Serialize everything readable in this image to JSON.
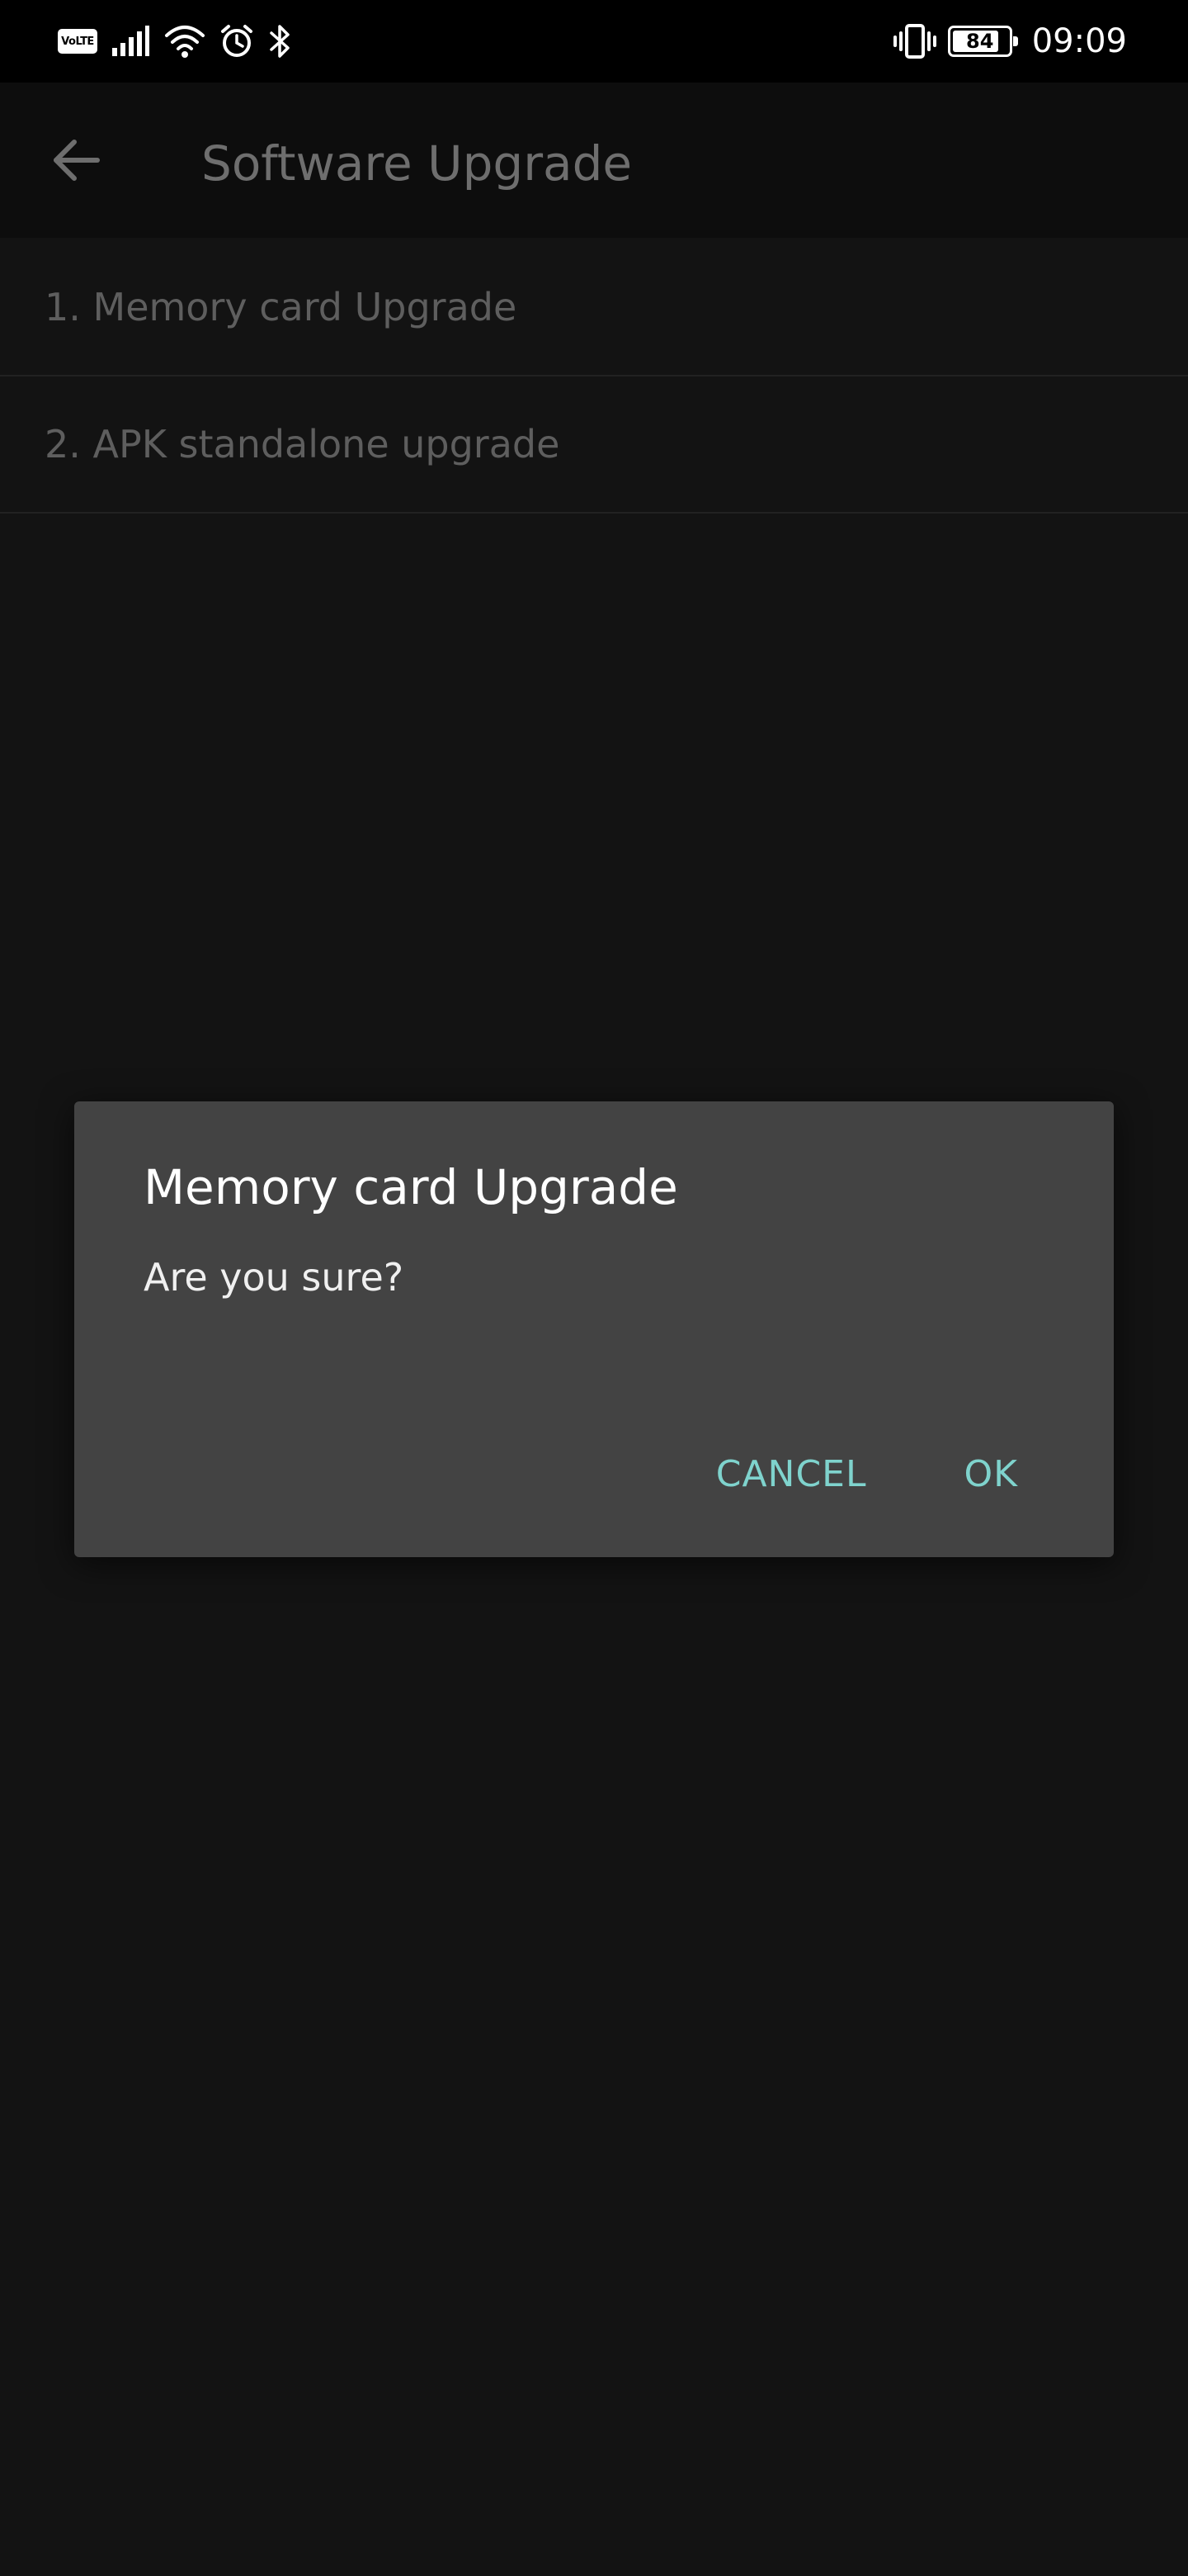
{
  "status_bar": {
    "volte_label": "VoLTE",
    "battery_level": "84",
    "battery_fraction": 0.84,
    "time": "09:09",
    "icons": [
      "volte-icon",
      "signal-icon",
      "wifi-icon",
      "alarm-icon",
      "bluetooth-icon",
      "vibrate-icon",
      "battery-icon"
    ]
  },
  "app_bar": {
    "title": "Software Upgrade",
    "back_icon": "arrow-left-icon"
  },
  "list": {
    "items": [
      {
        "label": "1. Memory card Upgrade"
      },
      {
        "label": "2. APK standalone upgrade"
      }
    ]
  },
  "dialog": {
    "title": "Memory card Upgrade",
    "message": "Are you sure?",
    "cancel_label": "CANCEL",
    "ok_label": "OK"
  },
  "colors": {
    "background": "#131313",
    "status_bar": "#000000",
    "dialog": "#434343",
    "accent": "#7fd3cd"
  }
}
